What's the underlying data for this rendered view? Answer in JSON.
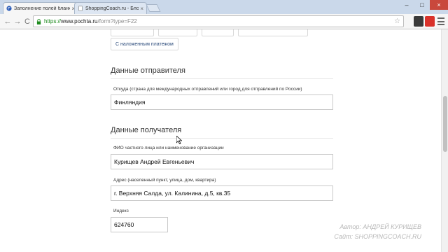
{
  "tabs": [
    {
      "title": "Заполнение полей бланк",
      "close": "×",
      "active": true
    },
    {
      "title": "ShoppingCoach.ru - Блог",
      "close": "×",
      "active": false
    }
  ],
  "window": {
    "minimize": "–",
    "maximize": "□",
    "close": "×"
  },
  "toolbar": {
    "back": "←",
    "forward": "→",
    "reload": "C",
    "url_scheme": "https://",
    "url_host": "www.pochta.ru",
    "url_path": "/form?type=F22",
    "star": "☆"
  },
  "options": {
    "cut_chips": [
      "",
      "",
      "",
      ""
    ],
    "cod_chip": "С наложенным платежом"
  },
  "sender": {
    "title": "Данные отправителя",
    "from_label": "Откуда (страна для международных отправлений или город для отправлений по России)",
    "from_value": "Финляндия"
  },
  "recipient": {
    "title": "Данные получателя",
    "name_label": "ФИО частного лица или наименование организации",
    "name_value": "Курищев Андрей Евгеньевич",
    "address_label": "Адрес (населенный пункт, улица, дом, квартира)",
    "address_value": "г. Верхняя Салда, ул. Калинина, д.5, кв.35",
    "index_label": "Индекс",
    "index_value": "624760"
  },
  "watermark": {
    "line1": "Автор: АНДРЕЙ КУРИЩЕВ",
    "line2": "Сайт: SHOPPINGCOACH.RU"
  },
  "colors": {
    "tabbar": "#cad8ea",
    "url_scheme": "#1d8a1d",
    "chip_text": "#2a4a7a"
  }
}
